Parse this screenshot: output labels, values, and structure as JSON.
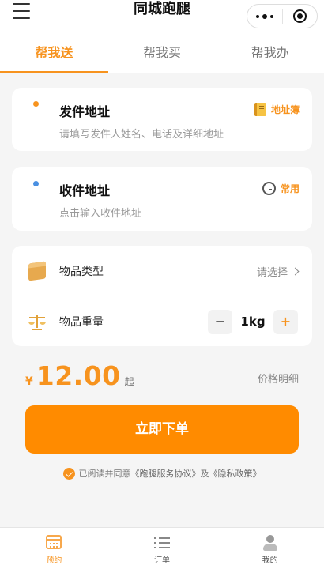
{
  "header": {
    "title": "同城跑腿",
    "menu_icon": "hamburger-icon",
    "capsule_icons": [
      "more-dots-icon",
      "target-icon"
    ]
  },
  "tabs": [
    {
      "label": "帮我送",
      "active": true
    },
    {
      "label": "帮我买",
      "active": false
    },
    {
      "label": "帮我办",
      "active": false
    }
  ],
  "sender": {
    "title": "发件地址",
    "placeholder": "请填写发件人姓名、电话及详细地址",
    "action": "地址簿",
    "action_icon": "address-book-icon",
    "dot_color": "#f7931e"
  },
  "receiver": {
    "title": "收件地址",
    "placeholder": "点击输入收件地址",
    "action": "常用",
    "action_icon": "clock-icon",
    "dot_color": "#4a90e2"
  },
  "goods": {
    "type_label": "物品类型",
    "type_value": "请选择",
    "type_icon": "box-icon",
    "weight_label": "物品重量",
    "weight_icon": "scale-icon",
    "weight_value": "1kg",
    "minus": "−",
    "plus": "+"
  },
  "price": {
    "currency": "¥",
    "amount": "12.00",
    "suffix": "起",
    "detail": "价格明细"
  },
  "submit_label": "立即下单",
  "agreement": {
    "prefix": "已阅读并同意",
    "service": "《跑腿服务协议》",
    "and": "及",
    "privacy": "《隐私政策》"
  },
  "tabbar": [
    {
      "label": "预约",
      "icon": "calendar-icon",
      "active": true
    },
    {
      "label": "订单",
      "icon": "list-icon",
      "active": false
    },
    {
      "label": "我的",
      "icon": "user-icon",
      "active": false
    }
  ],
  "colors": {
    "accent": "#f7931e",
    "button": "#ff8b00",
    "background": "#f5f5f5"
  }
}
